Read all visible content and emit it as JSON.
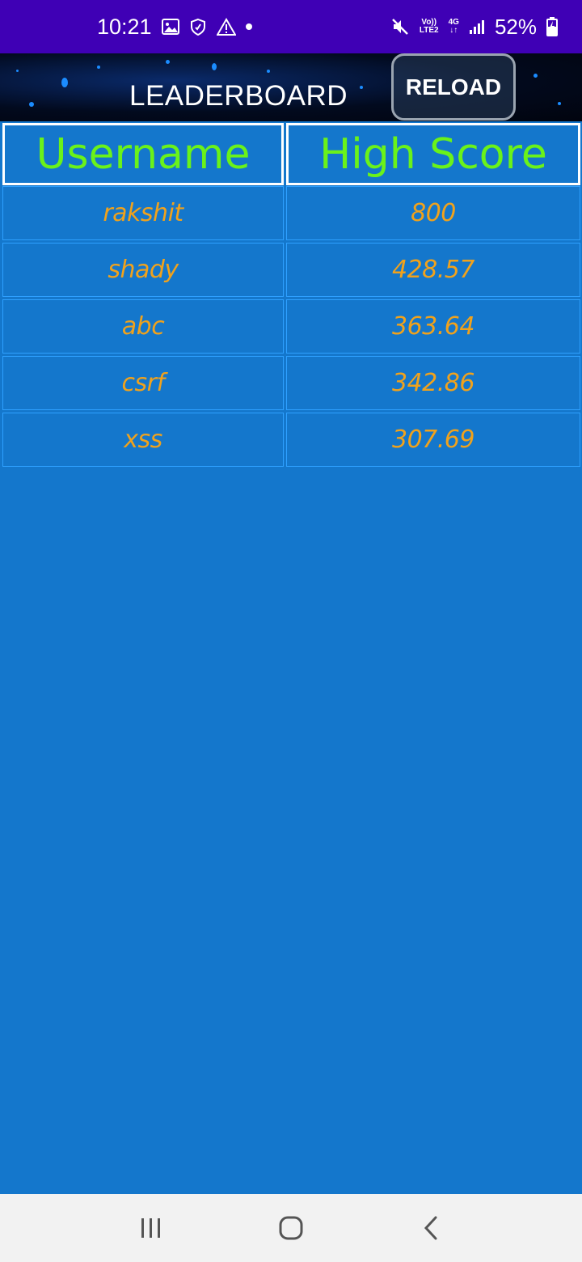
{
  "status_bar": {
    "time": "10:21",
    "volte_top": "Vo))",
    "volte_bottom": "LTE2",
    "network_top": "4G",
    "network_bottom": "↓↑",
    "battery": "52%"
  },
  "header": {
    "title": "LEADERBOARD",
    "reload_label": "RELOAD"
  },
  "table": {
    "columns": [
      "Username",
      "High Score"
    ],
    "rows": [
      {
        "username": "rakshit",
        "score": "800"
      },
      {
        "username": "shady",
        "score": "428.57"
      },
      {
        "username": "abc",
        "score": "363.64"
      },
      {
        "username": "csrf",
        "score": "342.86"
      },
      {
        "username": "xss",
        "score": "307.69"
      }
    ]
  },
  "colors": {
    "status_bar": "#3f00b5",
    "background": "#1477cc",
    "header_text": "#6af21a",
    "cell_text": "#f0a21c"
  }
}
